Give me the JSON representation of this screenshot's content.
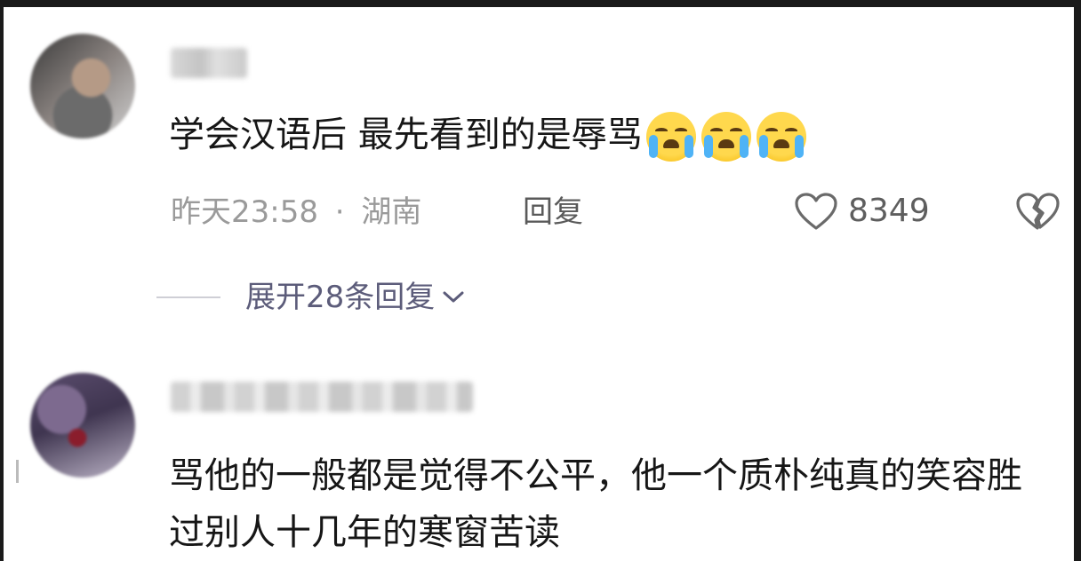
{
  "comments": [
    {
      "text": "学会汉语后 最先看到的是辱骂",
      "emojis": [
        "crying-face",
        "crying-face",
        "crying-face"
      ],
      "time": "昨天23:58",
      "separator": "·",
      "location": "湖南",
      "reply_label": "回复",
      "like_count": "8349",
      "expand_replies_label": "展开28条回复"
    },
    {
      "text": "骂他的一般都是觉得不公平，他一个质朴纯真的笑容胜过别人十几年的寒窗苦读"
    }
  ],
  "icons": {
    "like": "heart-outline-icon",
    "dislike": "broken-heart-icon",
    "expand": "chevron-down-icon"
  },
  "colors": {
    "text_primary": "#161616",
    "text_meta": "#9a9a9a",
    "expand_text": "#5c5c7a",
    "background": "#ffffff"
  }
}
